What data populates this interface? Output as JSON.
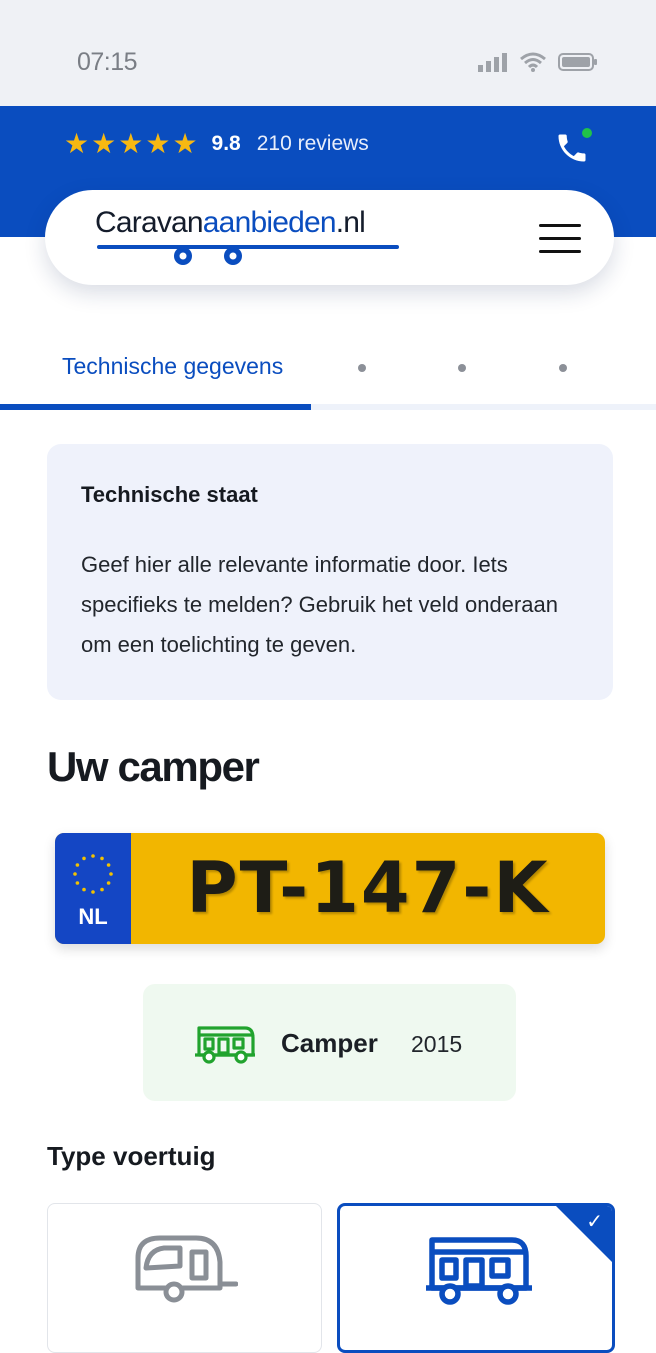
{
  "status_bar": {
    "time": "07:15"
  },
  "header": {
    "stars": [
      "★",
      "★",
      "★",
      "★",
      "★"
    ],
    "score": "9.8",
    "reviews": "210 reviews",
    "logo": {
      "part1": "Caravan",
      "part2": "aanbieden",
      "part3": ".nl"
    },
    "colors": {
      "brand_blue": "#0a4dbf",
      "star": "#f7b812",
      "online": "#21c24a"
    }
  },
  "tabs": {
    "active_label": "Technische gegevens",
    "step_count": 4,
    "active_step": 1
  },
  "info_box": {
    "title": "Technische staat",
    "body": "Geef hier alle relevante informatie door. Iets specifieks te melden? Gebruik het veld onderaan om een toelichting te geven."
  },
  "vehicle": {
    "section_title": "Uw camper",
    "plate_country": "NL",
    "plate_number": "PT-147-K",
    "type": "Camper",
    "year": "2015"
  },
  "vehicle_type": {
    "title": "Type voertuig",
    "options": [
      {
        "icon": "caravan-icon",
        "selected": false
      },
      {
        "icon": "camper-icon",
        "selected": true
      }
    ],
    "check_mark": "✓"
  }
}
